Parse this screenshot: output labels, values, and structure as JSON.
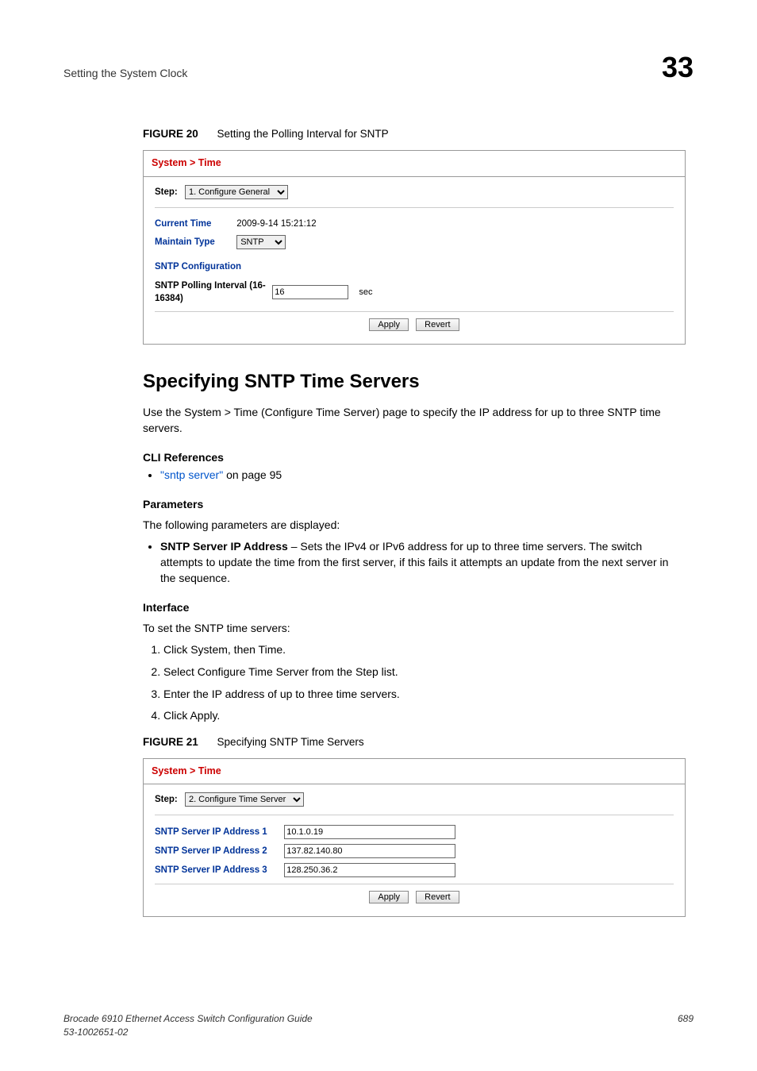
{
  "header": {
    "left": "Setting the System Clock",
    "right": "33"
  },
  "figure20": {
    "label": "FIGURE 20",
    "caption": "Setting the Polling Interval for SNTP",
    "panel_title": "System > Time",
    "step_label": "Step:",
    "step_option": "1. Configure General",
    "current_time_label": "Current Time",
    "current_time_value": "2009-9-14 15:21:12",
    "maintain_type_label": "Maintain Type",
    "maintain_type_value": "SNTP",
    "sntp_config_header": "SNTP Configuration",
    "poll_label": "SNTP Polling Interval (16-16384)",
    "poll_value": "16",
    "poll_unit": "sec",
    "apply": "Apply",
    "revert": "Revert"
  },
  "section": {
    "heading": "Specifying SNTP Time Servers",
    "intro": "Use the System > Time (Configure Time Server) page to specify the IP address for up to three SNTP time servers.",
    "cli_heading": "CLI References",
    "cli_link": "\"sntp server\"",
    "cli_link_suffix": " on page 95",
    "params_heading": "Parameters",
    "params_intro": "The following parameters are displayed:",
    "param_bold": "SNTP Server IP Address",
    "param_text": " – Sets the IPv4 or IPv6 address for up to three time servers. The switch attempts to update the time from the first server, if this fails it attempts an update from the next server in the sequence.",
    "interface_heading": "Interface",
    "interface_intro": "To set the SNTP time servers:",
    "steps": [
      "Click System, then Time.",
      "Select Configure Time Server from the Step list.",
      "Enter the IP address of up to three time servers.",
      "Click Apply."
    ]
  },
  "figure21": {
    "label": "FIGURE 21",
    "caption": "Specifying SNTP Time Servers",
    "panel_title": "System > Time",
    "step_label": "Step:",
    "step_option": "2. Configure Time Server",
    "addr1_label": "SNTP Server IP Address 1",
    "addr1_value": "10.1.0.19",
    "addr2_label": "SNTP Server IP Address 2",
    "addr2_value": "137.82.140.80",
    "addr3_label": "SNTP Server IP Address 3",
    "addr3_value": "128.250.36.2",
    "apply": "Apply",
    "revert": "Revert"
  },
  "footer": {
    "left_line1": "Brocade 6910 Ethernet Access Switch Configuration Guide",
    "left_line2": "53-1002651-02",
    "right": "689"
  }
}
